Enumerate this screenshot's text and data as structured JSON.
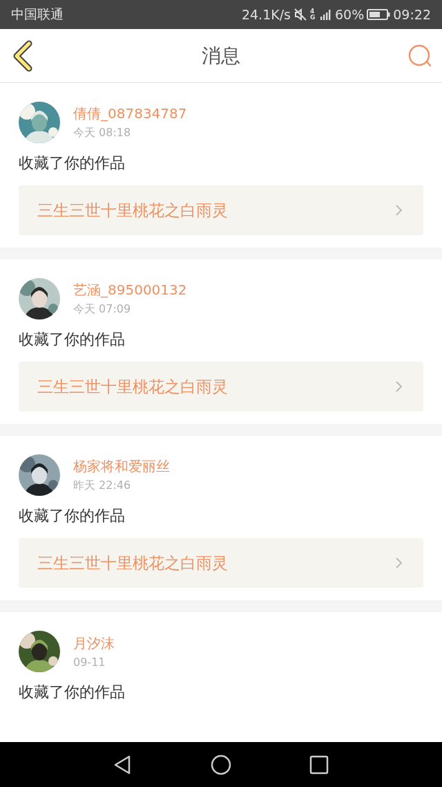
{
  "status_bar": {
    "carrier": "中国联通",
    "speed": "24.1K/s",
    "network": "4G",
    "battery": "60%",
    "time": "09:22"
  },
  "header": {
    "title": "消息"
  },
  "messages": [
    {
      "user": "倩倩_087834787",
      "time": "今天 08:18",
      "action": "收藏了你的作品",
      "link": "三生三世十里桃花之白雨灵"
    },
    {
      "user": "艺涵_895000132",
      "time": "今天 07:09",
      "action": "收藏了你的作品",
      "link": "三生三世十里桃花之白雨灵"
    },
    {
      "user": "杨家将和爱丽丝",
      "time": "昨天 22:46",
      "action": "收藏了你的作品",
      "link": "三生三世十里桃花之白雨灵"
    },
    {
      "user": "月汐沫",
      "time": "09-11",
      "action": "收藏了你的作品"
    }
  ]
}
